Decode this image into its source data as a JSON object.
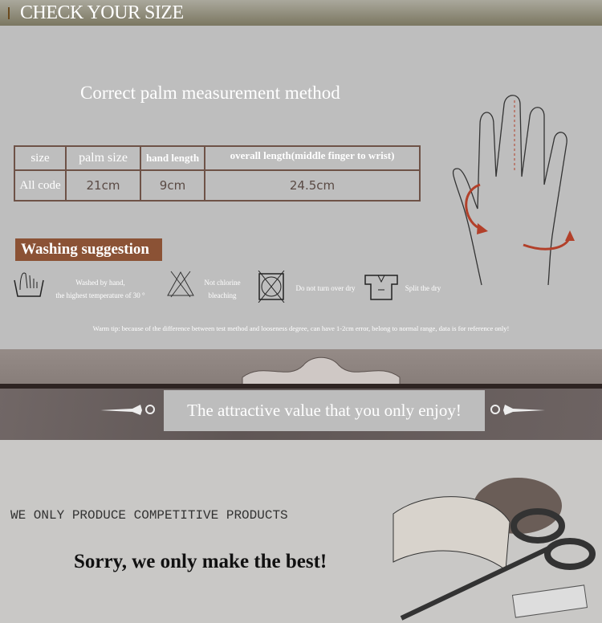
{
  "header": {
    "title": "CHECK YOUR SIZE"
  },
  "measure_title": "Correct palm measurement method",
  "size_table": {
    "headers": [
      "size",
      "palm size",
      "hand length",
      "overall length(middle finger to wrist)"
    ],
    "rows": [
      [
        "All code",
        "21cm",
        "9cm",
        "24.5cm"
      ]
    ]
  },
  "washing": {
    "title": "Washing suggestion",
    "items": [
      {
        "icon": "hand-wash-icon",
        "label_lines": [
          "Washed by hand,",
          "the highest temperature of 30 °"
        ]
      },
      {
        "icon": "no-bleach-icon",
        "label_lines": [
          "Not chlorine",
          "bleaching"
        ]
      },
      {
        "icon": "no-tumble-dry-icon",
        "label_lines": [
          "Do not turn over dry"
        ]
      },
      {
        "icon": "dry-flat-icon",
        "label_lines": [
          "Split the dry"
        ]
      }
    ]
  },
  "warm_tip": "Warm tip: because of the difference between test method and looseness degree, can have 1-2cm error, belong to normal range, data is for reference only!",
  "banner": {
    "text": "The attractive value that you only enjoy!"
  },
  "tagline": "WE ONLY PRODUCE COMPETITIVE PRODUCTS",
  "slogan": "Sorry, we only make the best!",
  "colors": {
    "accent": "#8b5235",
    "table_border": "#6e5247",
    "arrow": "#b2402a"
  }
}
